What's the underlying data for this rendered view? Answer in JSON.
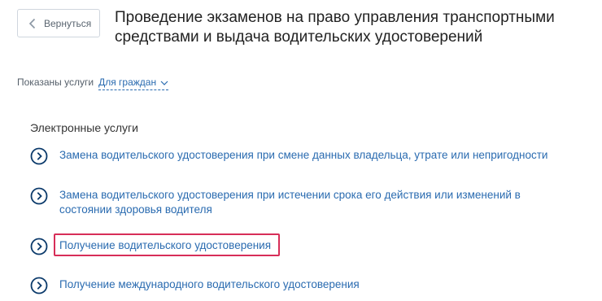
{
  "back_button": {
    "label": "Вернуться",
    "icon": "chevron-left-icon"
  },
  "page_title": "Проведение экзаменов на право управления транспортными средствами и выдача водительских удостоверений",
  "filter": {
    "label": "Показаны услуги",
    "selected_value": "Для граждан",
    "icon": "chevron-down-icon"
  },
  "section": {
    "title": "Электронные услуги",
    "items": [
      {
        "label": "Замена водительского удостоверения при смене данных владельца, утрате или непригодности",
        "icon": "arrow-circle-icon"
      },
      {
        "label": "Замена водительского удостоверения при истечении срока его действия или изменений в состоянии здоровья водителя",
        "icon": "arrow-circle-icon"
      },
      {
        "label": "Получение водительского удостоверения",
        "icon": "arrow-circle-icon",
        "highlighted": true
      },
      {
        "label": "Получение международного водительского удостоверения",
        "icon": "arrow-circle-icon"
      }
    ]
  },
  "colors": {
    "link": "#2a6bb0",
    "icon_circle": "#0b3a6b",
    "highlight": "#d72e58",
    "border": "#cfd6de"
  }
}
